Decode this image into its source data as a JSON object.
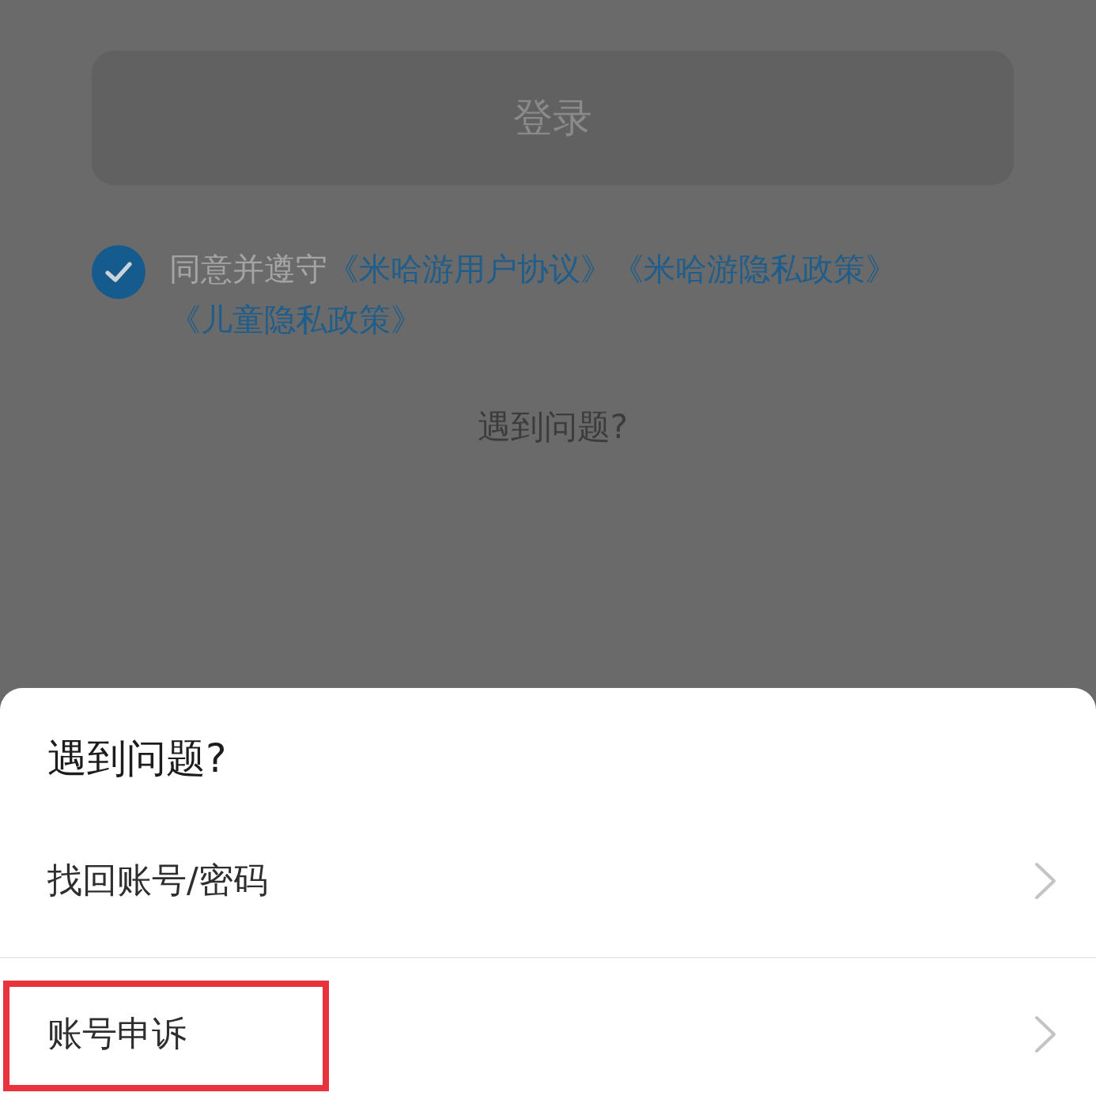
{
  "login_screen": {
    "login_button": {
      "label": "登录",
      "disabled": true
    },
    "agreement": {
      "checked": true,
      "parts": [
        {
          "kind": "text",
          "text": "同意并遵守"
        },
        {
          "kind": "link",
          "text": "《米哈游用户协议》"
        },
        {
          "kind": "link",
          "text": "《米哈游隐私政策》"
        },
        {
          "kind": "link",
          "text": "《儿童隐私政策》"
        }
      ]
    },
    "help_link": "遇到问题?"
  },
  "sheet": {
    "title": "遇到问题?",
    "items": [
      {
        "label": "找回账号/密码",
        "highlighted": false
      },
      {
        "label": "账号申诉",
        "highlighted": true
      }
    ]
  }
}
